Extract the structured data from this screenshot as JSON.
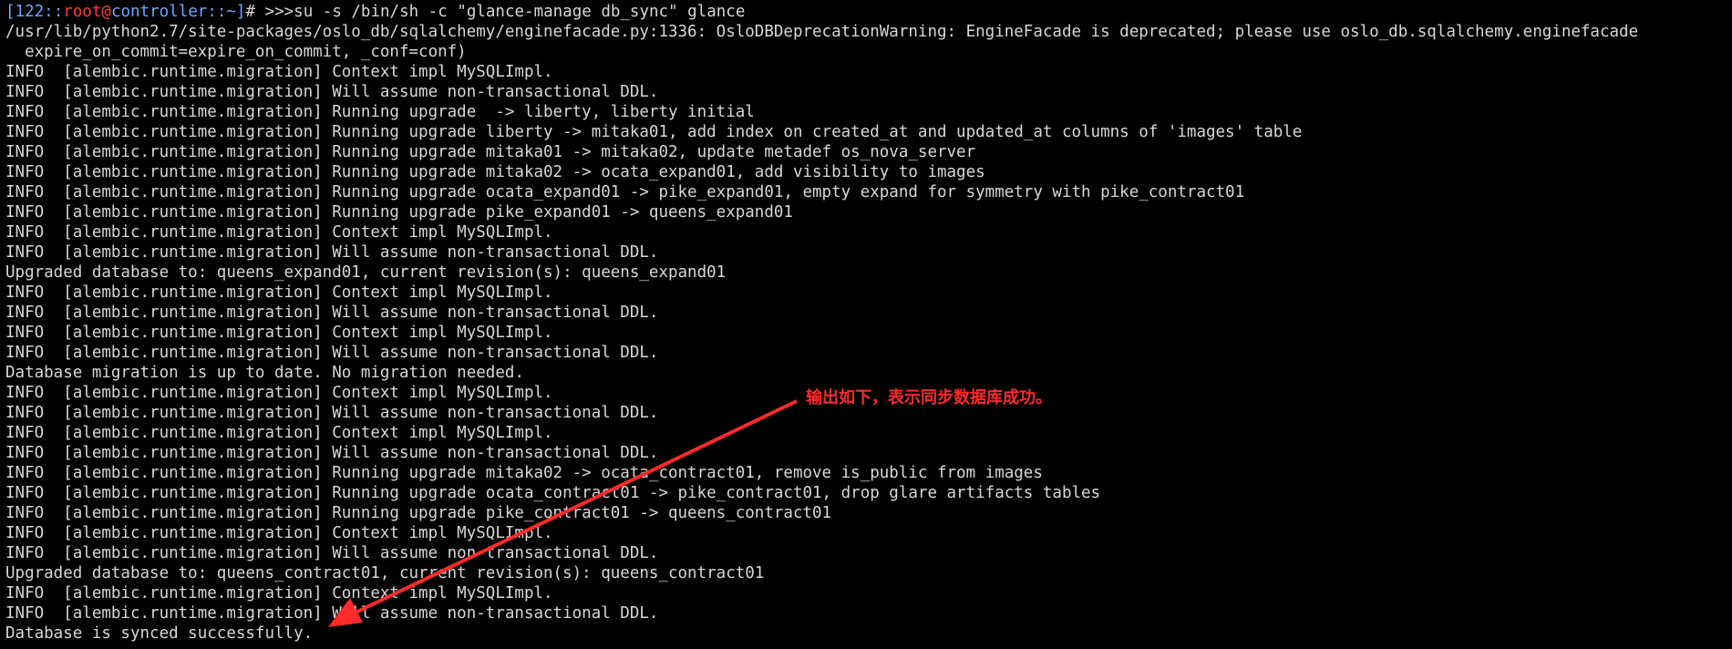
{
  "terminal": {
    "prompt": {
      "open_bracket": "[",
      "host_id": "122::",
      "user": "root",
      "at": "@",
      "host": "controller",
      "sep": "::",
      "path": "~",
      "close_bracket": "]",
      "hash": "#",
      "marker": " >>>",
      "command": "su -s /bin/sh -c \"glance-manage db_sync\" glance"
    },
    "output_lines": [
      "/usr/lib/python2.7/site-packages/oslo_db/sqlalchemy/enginefacade.py:1336: OsloDBDeprecationWarning: EngineFacade is deprecated; please use oslo_db.sqlalchemy.enginefacade",
      "  expire_on_commit=expire_on_commit, _conf=conf)",
      "INFO  [alembic.runtime.migration] Context impl MySQLImpl.",
      "INFO  [alembic.runtime.migration] Will assume non-transactional DDL.",
      "INFO  [alembic.runtime.migration] Running upgrade  -> liberty, liberty initial",
      "INFO  [alembic.runtime.migration] Running upgrade liberty -> mitaka01, add index on created_at and updated_at columns of 'images' table",
      "INFO  [alembic.runtime.migration] Running upgrade mitaka01 -> mitaka02, update metadef os_nova_server",
      "INFO  [alembic.runtime.migration] Running upgrade mitaka02 -> ocata_expand01, add visibility to images",
      "INFO  [alembic.runtime.migration] Running upgrade ocata_expand01 -> pike_expand01, empty expand for symmetry with pike_contract01",
      "INFO  [alembic.runtime.migration] Running upgrade pike_expand01 -> queens_expand01",
      "INFO  [alembic.runtime.migration] Context impl MySQLImpl.",
      "INFO  [alembic.runtime.migration] Will assume non-transactional DDL.",
      "Upgraded database to: queens_expand01, current revision(s): queens_expand01",
      "INFO  [alembic.runtime.migration] Context impl MySQLImpl.",
      "INFO  [alembic.runtime.migration] Will assume non-transactional DDL.",
      "INFO  [alembic.runtime.migration] Context impl MySQLImpl.",
      "INFO  [alembic.runtime.migration] Will assume non-transactional DDL.",
      "Database migration is up to date. No migration needed.",
      "INFO  [alembic.runtime.migration] Context impl MySQLImpl.",
      "INFO  [alembic.runtime.migration] Will assume non-transactional DDL.",
      "INFO  [alembic.runtime.migration] Context impl MySQLImpl.",
      "INFO  [alembic.runtime.migration] Will assume non-transactional DDL.",
      "INFO  [alembic.runtime.migration] Running upgrade mitaka02 -> ocata_contract01, remove is_public from images",
      "INFO  [alembic.runtime.migration] Running upgrade ocata_contract01 -> pike_contract01, drop glare artifacts tables",
      "INFO  [alembic.runtime.migration] Running upgrade pike_contract01 -> queens_contract01",
      "INFO  [alembic.runtime.migration] Context impl MySQLImpl.",
      "INFO  [alembic.runtime.migration] Will assume non-transactional DDL.",
      "Upgraded database to: queens_contract01, current revision(s): queens_contract01",
      "INFO  [alembic.runtime.migration] Context impl MySQLImpl.",
      "INFO  [alembic.runtime.migration] Will assume non-transactional DDL.",
      "Database is synced successfully."
    ]
  },
  "annotation": {
    "text": "输出如下，表示同步数据库成功。",
    "color": "#ff2a2a"
  },
  "colors": {
    "background": "#000000",
    "text": "#d7d7d7",
    "prompt_blue": "#6ea8ff",
    "prompt_red": "#ff3b3b"
  }
}
